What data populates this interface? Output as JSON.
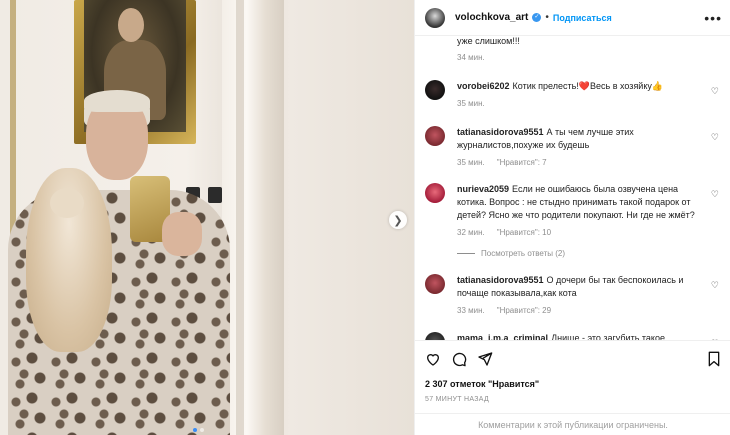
{
  "post": {
    "username": "volochkova_art",
    "follow_label": "Подписаться",
    "separator": "•"
  },
  "caption_fragment": {
    "text": "уже слишком!!!",
    "time": "34 мин."
  },
  "comments": [
    {
      "user": "vorobei6202",
      "text": "Котик прелесть!❤️Весь в хозяйку👍",
      "time": "35 мин.",
      "likes": ""
    },
    {
      "user": "tatianasidorova9551",
      "text": "А ты чем лучше этих журналистов,похуже их будешь",
      "time": "35 мин.",
      "likes": "\"Нравится\": 7"
    },
    {
      "user": "nurieva2059",
      "text": "Если не ошибаюсь была озвучена цена котика. Вопрос : не стыдно принимать такой подарок от детей? Ясно же что родители покупают. Ни где не жмёт?",
      "time": "32 мин.",
      "likes": "\"Нравится\": 10"
    },
    {
      "user": "tatianasidorova9551",
      "text": "О дочери бы так беспокоилась и почаще показывала,как кота",
      "time": "33 мин.",
      "likes": "\"Нравится\": 29"
    },
    {
      "user": "mama_i.m.a_criminal",
      "text": "Днище - это загубить такое",
      "time": "",
      "likes": ""
    }
  ],
  "replies_label": "Посмотреть ответы (2)",
  "actions": {
    "likes_text": "2 307 отметок \"Нравится\"",
    "time_ago": "57 МИНУТ НАЗАД",
    "comments_limited": "Комментарии к этой публикации ограничены."
  },
  "icons": {
    "like": "heart-icon",
    "comment": "comment-icon",
    "share": "share-icon",
    "save": "bookmark-icon",
    "more": "more-icon",
    "next": "chevron-right-icon"
  },
  "colors": {
    "link": "#0095f6",
    "verified": "#3897f0",
    "muted": "#8e8e8e"
  }
}
